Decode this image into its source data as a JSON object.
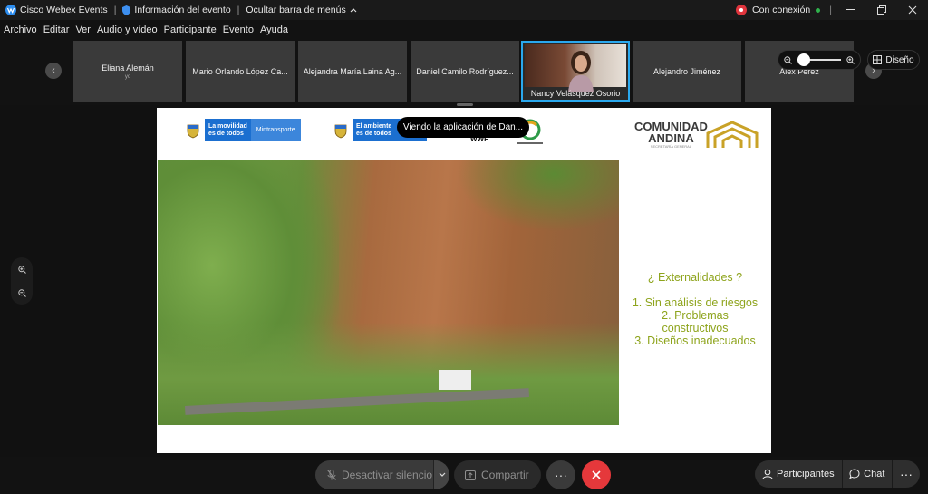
{
  "titlebar": {
    "app_name": "Cisco Webex Events",
    "sep1": "|",
    "event_info": "Información del evento",
    "sep2": "|",
    "hide_menu": "Ocultar barra de menús",
    "status": "Con conexión"
  },
  "menu": [
    "Archivo",
    "Editar",
    "Ver",
    "Audio y vídeo",
    "Participante",
    "Evento",
    "Ayuda"
  ],
  "participants": [
    {
      "name": "Eliana Alemán",
      "sub": "yo"
    },
    {
      "name": "Mario Orlando López Ca..."
    },
    {
      "name": "Alejandra María Laina Ag..."
    },
    {
      "name": "Daniel Camilo Rodríguez..."
    },
    {
      "name": "Nancy Velásquez Osorio"
    },
    {
      "name": "Alejandro Jiménez"
    },
    {
      "name": "Alex Pérez"
    }
  ],
  "layout_button": "Diseño",
  "tooltip": "Viendo la aplicación de Dan...",
  "slide": {
    "badge1_line1": "La movilidad",
    "badge1_line2": "es de todos",
    "badge1_ministry": "Mintransporte",
    "badge2_line1": "El ambiente",
    "badge2_line2": "es de todos",
    "wwf": "WWF",
    "can_line1": "COMUNIDAD",
    "can_line2": "ANDINA",
    "can_sub": "SECRETARÍA GENERAL",
    "question": "¿ Externalidades ?",
    "item1": "1. Sin análisis de riesgos",
    "item2a": "2. Problemas",
    "item2b": "constructivos",
    "item3": "3. Diseños inadecuados"
  },
  "bottom": {
    "mute": "Desactivar silencio",
    "share": "Compartir",
    "participants": "Participantes",
    "chat": "Chat"
  },
  "colors": {
    "accent": "#2aa8ee",
    "end_call": "#e5383b",
    "slide_text": "#8ea41c"
  }
}
